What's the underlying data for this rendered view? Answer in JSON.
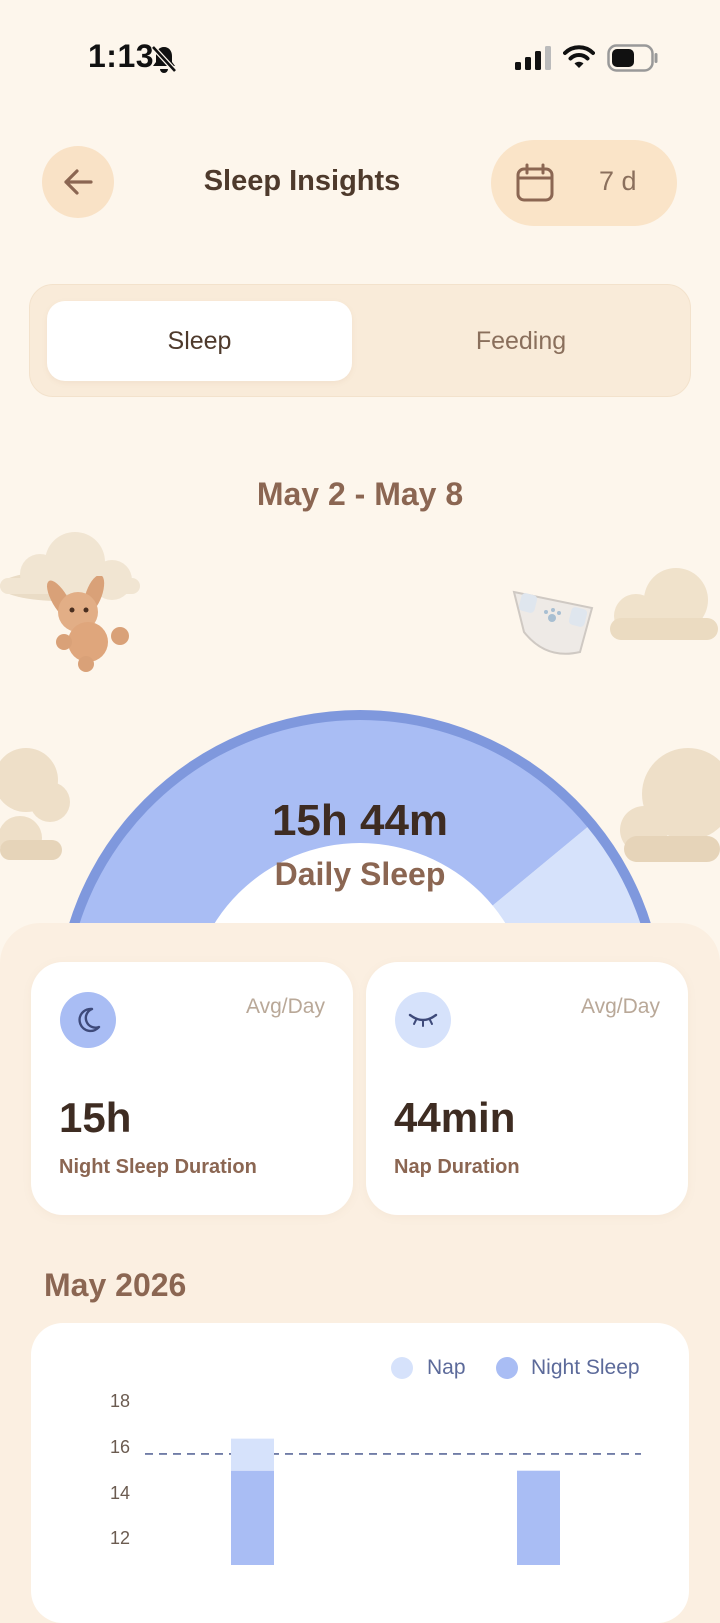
{
  "status_bar": {
    "time": "1:13"
  },
  "header": {
    "title": "Sleep Insights",
    "range_label": "7 d"
  },
  "tabs": [
    {
      "label": "Sleep",
      "active": true
    },
    {
      "label": "Feeding",
      "active": false
    }
  ],
  "date_range": "May 2 - May 8",
  "summary": {
    "value": "15h 44m",
    "label": "Daily Sleep",
    "night_fraction": 0.95,
    "colors": {
      "night": "#a9bdf4",
      "nap": "#d6e2fb",
      "ring": "#7f98dd"
    }
  },
  "stats": [
    {
      "icon": "moon-icon",
      "per": "Avg/Day",
      "value": "15h",
      "label": "Night Sleep Duration"
    },
    {
      "icon": "closed-eye-icon",
      "per": "Avg/Day",
      "value": "44min",
      "label": "Nap Duration"
    }
  ],
  "chart_section": {
    "title": "May 2026"
  },
  "chart_data": {
    "type": "bar",
    "stacked": true,
    "legend": [
      {
        "name": "Nap",
        "color": "#d6e2fb"
      },
      {
        "name": "Night Sleep",
        "color": "#a9bdf4"
      }
    ],
    "y_ticks": [
      "18",
      "16",
      "14",
      "12"
    ],
    "y_tick_values": [
      18,
      16,
      14,
      12
    ],
    "reference_line": 15.73,
    "series": [
      {
        "name": "Night Sleep",
        "values": [
          15.0,
          15.0
        ]
      },
      {
        "name": "Nap",
        "values": [
          1.4,
          0
        ]
      }
    ]
  }
}
